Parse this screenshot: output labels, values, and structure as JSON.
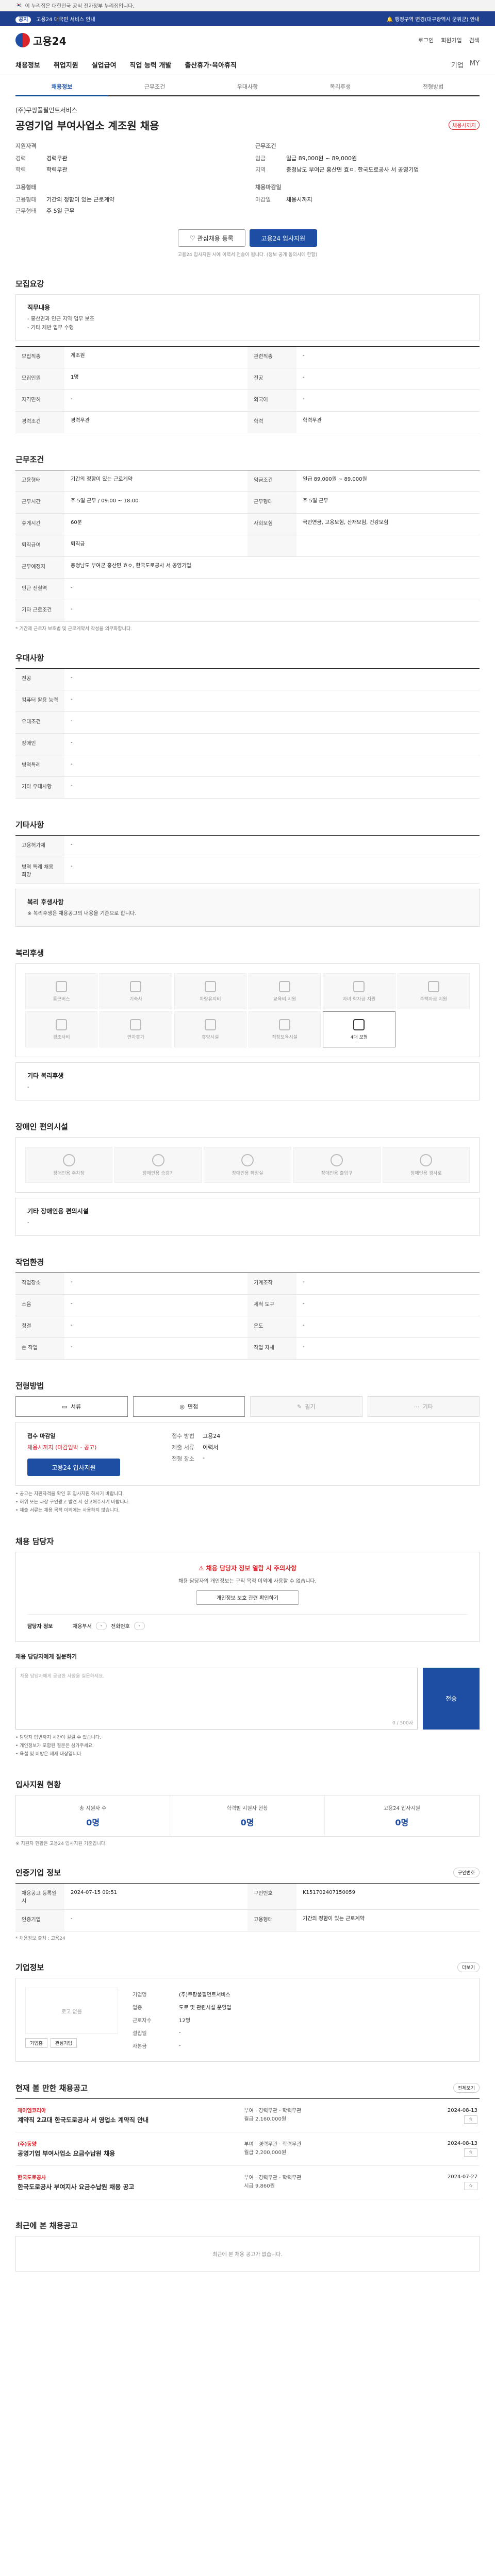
{
  "gov_banner": "이 누리집은 대한민국 공식 전자정부 누리집입니다.",
  "notice": {
    "tag": "공지",
    "text": "고용24 대국민 서비스 안내",
    "right": "🔔 행정구역 변경(대구광역시 군위군) 안내"
  },
  "header": {
    "logo": "고용24",
    "util": [
      "로그인",
      "회원가입",
      "검색"
    ]
  },
  "gnb": {
    "items": [
      "채용정보",
      "취업지원",
      "실업급여",
      "직업 능력 개발",
      "출산휴가·육아휴직"
    ],
    "right": [
      "기업",
      "MY"
    ]
  },
  "tabs": [
    "채용정보",
    "근무조건",
    "우대사항",
    "복리후생",
    "전형방법"
  ],
  "job": {
    "company": "(주)쿠팡풀필먼트서비스",
    "title": "공영기업 부여사업소 계조원 채용",
    "badge": "채용시까지",
    "qual_head": "지원자격",
    "cond_head": "근무조건",
    "qual": [
      {
        "k": "경력",
        "v": "경력무관"
      },
      {
        "k": "학력",
        "v": "학력무관"
      }
    ],
    "cond": [
      {
        "k": "임금",
        "v": "일급 89,000원 ~ 89,000원"
      },
      {
        "k": "지역",
        "v": "충청남도 부여군 홍산면 효ㅇ, 한국도로공사 서 공영기업"
      }
    ],
    "type_head": "고용형태",
    "type": [
      {
        "k": "고용형태",
        "v": "기간의 정함이 있는 근로계약"
      },
      {
        "k": "근무형태",
        "v": "주 5일 근무"
      }
    ],
    "date_head": "채용마감일",
    "date": [
      {
        "k": "마감일",
        "v": "채용시까지"
      }
    ]
  },
  "actions": {
    "scrap": "관심채용 등록",
    "apply": "고용24 입사지원",
    "note": "고용24 입사지원 시에 이력서 전송이 됩니다. (정보 공개 동의시에 한함)"
  },
  "recruit": {
    "heading": "모집요강",
    "box_title": "직무내용",
    "box_lines": [
      "- 홍산면과 인근 지역 업무 보조",
      "- 기타 제반 업무 수행"
    ],
    "rows": [
      {
        "k": "모집직종",
        "v": "계조원"
      },
      {
        "k": "관련직종",
        "v": "-"
      },
      {
        "k": "모집인원",
        "v": "1명"
      },
      {
        "k": "전공",
        "v": "-"
      },
      {
        "k": "자격면허",
        "v": "-"
      },
      {
        "k": "외국어",
        "v": "-"
      },
      {
        "k": "경력조건",
        "v": "경력무관"
      },
      {
        "k": "학력",
        "v": "학력무관"
      }
    ]
  },
  "work": {
    "heading": "근무조건",
    "rows": [
      {
        "k": "고용형태",
        "v": "기간의 정함이 있는 근로계약",
        "full": false
      },
      {
        "k": "임금조건",
        "v": "일급 89,000원 ~ 89,000원",
        "full": false
      },
      {
        "k": "근무시간",
        "v": "주 5일 근무 / 09:00 ~ 18:00",
        "full": false
      },
      {
        "k": "근무형태",
        "v": "주 5일 근무",
        "full": false
      },
      {
        "k": "휴게시간",
        "v": "60분",
        "full": false
      },
      {
        "k": "사회보험",
        "v": "국민연금, 고용보험, 산재보험, 건강보험",
        "full": false
      },
      {
        "k": "퇴직급여",
        "v": "퇴직금",
        "full": false
      },
      {
        "k": "근무예정지",
        "v": "충청남도 부여군 홍산면 효ㅇ, 한국도로공사 서 공영기업",
        "full": true
      },
      {
        "k": "인근 전철역",
        "v": "-",
        "full": true
      },
      {
        "k": "기타 근로조건",
        "v": "-",
        "full": true
      }
    ],
    "note": "* 기간제 근로자 보호법 및 근로계약서 작성을 의무화합니다."
  },
  "prefer": {
    "heading": "우대사항",
    "rows": [
      {
        "k": "전공",
        "v": "-"
      },
      {
        "k": "컴퓨터 활용 능력",
        "v": "-"
      },
      {
        "k": "우대조건",
        "v": "-"
      },
      {
        "k": "장애인",
        "v": "-"
      },
      {
        "k": "병역특례",
        "v": "-"
      },
      {
        "k": "기타 우대사항",
        "v": "-"
      }
    ]
  },
  "other": {
    "heading": "기타사항",
    "rows": [
      {
        "k": "고용허가제",
        "v": "-"
      },
      {
        "k": "병역 특례 채용 희망",
        "v": "-"
      }
    ],
    "box_title": "복리 후생사항",
    "box_text": "※ 복리후생은 채용공고의 내용을 기준으로 합니다."
  },
  "welfare": {
    "heading": "복리후생",
    "items": [
      {
        "label": "통근버스",
        "on": false
      },
      {
        "label": "기숙사",
        "on": false
      },
      {
        "label": "차량유지비",
        "on": false
      },
      {
        "label": "교육비 지원",
        "on": false
      },
      {
        "label": "자녀 학자금 지원",
        "on": false
      },
      {
        "label": "주택자금 지원",
        "on": false
      },
      {
        "label": "경조사비",
        "on": false
      },
      {
        "label": "연차휴가",
        "on": false
      },
      {
        "label": "휴양시설",
        "on": false
      },
      {
        "label": "직장보육시설",
        "on": false
      },
      {
        "label": "4대 보험",
        "on": true
      }
    ],
    "extra_title": "기타 복리후생",
    "extra_value": "-"
  },
  "disabled": {
    "heading": "장애인 편의시설",
    "items": [
      "장애인용 주차장",
      "장애인용 승강기",
      "장애인용 화장실",
      "장애인용 출입구",
      "장애인용 경사로"
    ],
    "extra_title": "기타 장애인용 편의시설",
    "extra_value": "-"
  },
  "place": {
    "heading": "작업환경",
    "rows": [
      {
        "k": "작업장소",
        "v": "-"
      },
      {
        "k": "기계조작",
        "v": "-"
      },
      {
        "k": "소음",
        "v": "-"
      },
      {
        "k": "세척 도구",
        "v": "-"
      },
      {
        "k": "청결",
        "v": "-"
      },
      {
        "k": "온도",
        "v": "-"
      },
      {
        "k": "손 작업",
        "v": "-"
      },
      {
        "k": "작업 자세",
        "v": "-"
      }
    ]
  },
  "method": {
    "heading": "전형방법",
    "items": [
      {
        "label": "서류",
        "on": true
      },
      {
        "label": "면접",
        "on": true
      },
      {
        "label": "필기",
        "on": false
      },
      {
        "label": "기타",
        "on": false
      }
    ],
    "apply_title": "접수 마감일",
    "apply_date": "채용시까지 (마감임박 - 공고)",
    "apply_btn": "고용24 입사지원",
    "right": [
      {
        "k": "접수 방법",
        "v": "고용24"
      },
      {
        "k": "제출 서류",
        "v": "이력서"
      },
      {
        "k": "전형 장소",
        "v": "-"
      }
    ],
    "notes": [
      "• 공고는 지원자격을 확인 후 입사지원 하시기 바랍니다.",
      "• 허위 또는 과장 구인광고 발견 시 신고해주시기 바랍니다.",
      "• 제출 서류는 채용 목적 이외에는 사용하지 않습니다."
    ]
  },
  "contact": {
    "heading": "채용 담당자",
    "warn_title": "채용 담당자 정보 열람 시 주의사항",
    "warn_text": "채용 담당자의 개인정보는 구직 목적 이외에 사용할 수 없습니다.",
    "login_label": "담당자 정보",
    "login_btn": "개인정보 보호 관련 확인하기",
    "rows": [
      {
        "k": "채용부서",
        "v": "-"
      },
      {
        "k": "전화번호",
        "v": "-"
      }
    ],
    "q_title": "채용 담당자에게 질문하기",
    "q_placeholder": "채용 담당자에게 궁금한 사항을 질문하세요.",
    "q_count": "0 / 500자",
    "q_btn": "전송",
    "bullets": [
      "• 담당자 답변까지 시간이 걸릴 수 있습니다.",
      "• 개인정보가 포함된 질문은 삼가주세요.",
      "• 욕설 및 비방은 제재 대상입니다."
    ]
  },
  "stats": {
    "heading": "입사지원 현황",
    "items": [
      {
        "label": "총 지원자 수",
        "value": "0명"
      },
      {
        "label": "학력별 지원자 현황",
        "value": "0명"
      },
      {
        "label": "고용24 입사지원",
        "value": "0명"
      }
    ],
    "note": "※ 지원자 현황은 고용24 입사지원 기준입니다."
  },
  "info": {
    "heading": "인증기업 정보",
    "chip": "구인번호",
    "rows": [
      {
        "k": "채용공고 등록일시",
        "v": "2024-07-15 09:51"
      },
      {
        "k": "구인번호",
        "v": "K151702407150059"
      },
      {
        "k": "인증기업",
        "v": "-"
      },
      {
        "k": "고용형태",
        "v": "기간의 정함이 있는 근로계약"
      }
    ],
    "note": "* 채용정보 출처 : 고용24"
  },
  "corp": {
    "heading": "기업정보",
    "chip": "더보기",
    "logo": "로고 없음",
    "btns": [
      "기업홈",
      "관심기업"
    ],
    "rows": [
      {
        "k": "기업명",
        "v": "(주)쿠팡풀필먼트서비스"
      },
      {
        "k": "업종",
        "v": "도로 및 관련시설 운영업"
      },
      {
        "k": "근로자수",
        "v": "12명"
      },
      {
        "k": "설립일",
        "v": "-"
      },
      {
        "k": "자본금",
        "v": "-"
      }
    ]
  },
  "recommend": {
    "heading": "현재 볼 만한 채용공고",
    "chip": "전체보기",
    "items": [
      {
        "co": "제이엠코리아",
        "title": "계약직 2교대 한국도로공사 서 영업소 계약직 안내",
        "meta": "부여 · 경력무관 · 학력무관",
        "wage": "월급 2,160,000원",
        "deadline": "2024-08-13"
      },
      {
        "co": "(주)동양",
        "title": "공영기업 부여사업소 요금수납원 채용",
        "meta": "부여 · 경력무관 · 학력무관",
        "wage": "월급 2,200,000원",
        "deadline": "2024-08-13"
      },
      {
        "co": "한국도로공사",
        "title": "한국도로공사 부여지사 요금수납원 채용 공고",
        "meta": "부여 · 경력무관 · 학력무관",
        "wage": "시급 9,860원",
        "deadline": "2024-07-27"
      }
    ]
  },
  "recent": {
    "heading": "최근에 본 채용공고",
    "empty": "최근에 본 채용 공고가 없습니다."
  }
}
